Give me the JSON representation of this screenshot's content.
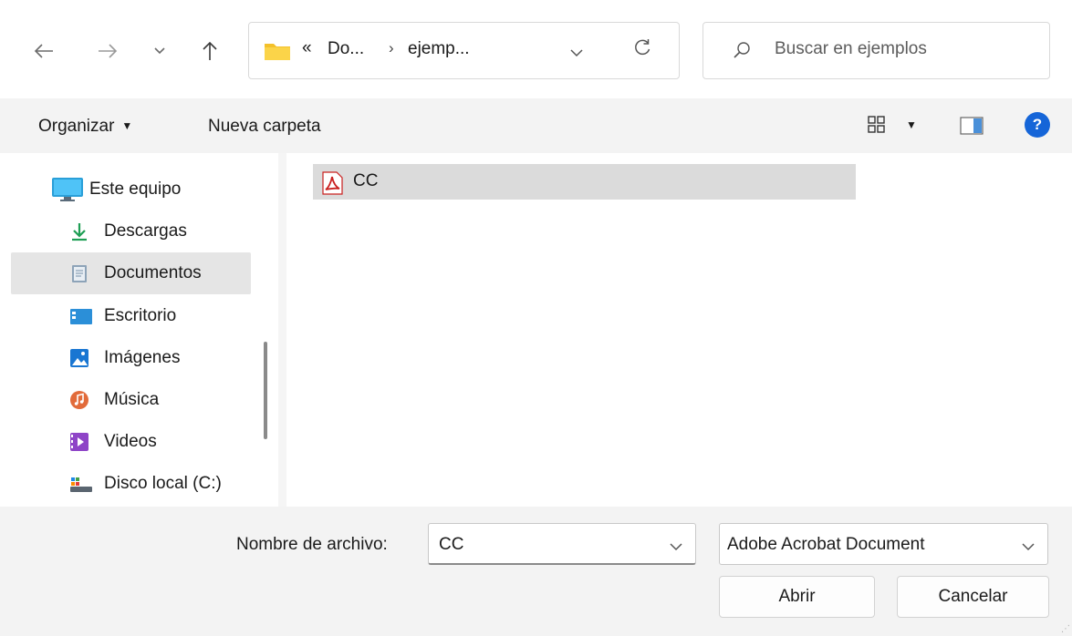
{
  "address": {
    "overflow_glyph": "«",
    "crumbs": [
      "Do...",
      "ejemp..."
    ],
    "separator": "›"
  },
  "search": {
    "placeholder": "Buscar en ejemplos"
  },
  "toolbar": {
    "organize_label": "Organizar",
    "new_folder_label": "Nueva carpeta"
  },
  "nav": {
    "items": [
      {
        "label": "Este equipo",
        "icon": "computer-icon"
      },
      {
        "label": "Descargas",
        "icon": "download-icon"
      },
      {
        "label": "Documentos",
        "icon": "documents-icon",
        "selected": true
      },
      {
        "label": "Escritorio",
        "icon": "desktop-icon"
      },
      {
        "label": "Imágenes",
        "icon": "pictures-icon"
      },
      {
        "label": "Música",
        "icon": "music-icon"
      },
      {
        "label": "Videos",
        "icon": "videos-icon"
      },
      {
        "label": "Disco local (C:)",
        "icon": "local-disk-icon"
      }
    ]
  },
  "files": [
    {
      "name": "CC",
      "icon": "pdf-file-icon",
      "selected": true
    }
  ],
  "bottom": {
    "filename_label": "Nombre de archivo:",
    "filename_value": "CC",
    "filetype_value": "Adobe Acrobat Document",
    "open_label": "Abrir",
    "cancel_label": "Cancelar"
  },
  "colors": {
    "accent": "#1565d8",
    "selection": "#e5e5e5",
    "file_selection": "#dbdbdb",
    "pdf_red": "#c9201f",
    "folder_yellow": "#f4c12a"
  }
}
